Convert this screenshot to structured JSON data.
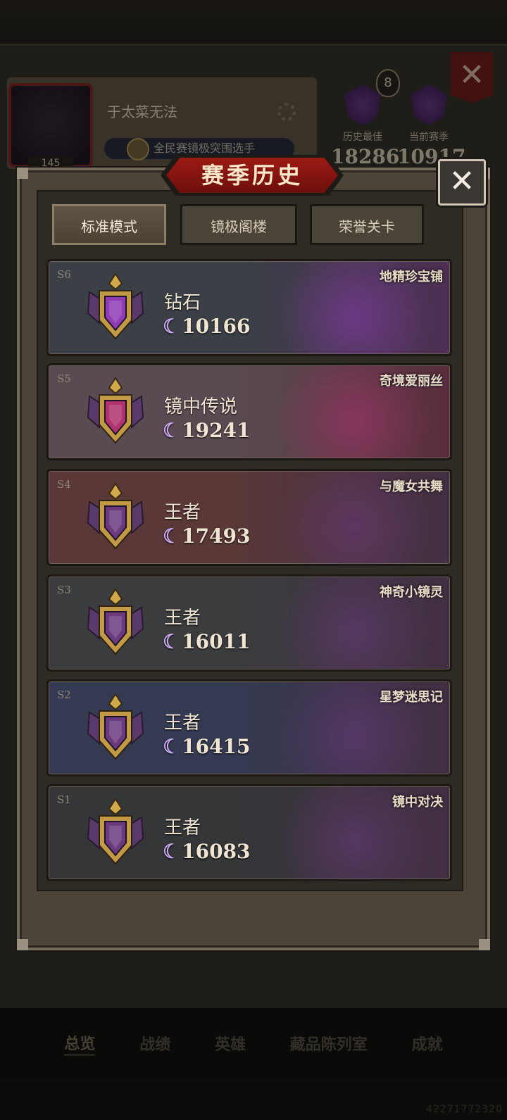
{
  "profile": {
    "player_name": "于太菜无法",
    "level": "145",
    "title_text": "全民赛镜极突围选手",
    "star_count": "8",
    "stats": [
      {
        "label": "历史最佳",
        "value": "18286"
      },
      {
        "label": "当前赛季",
        "value": "10917"
      }
    ]
  },
  "bottom_nav": [
    "总览",
    "战绩",
    "英雄",
    "藏品陈列室",
    "成就"
  ],
  "corner_id": "42271772320",
  "modal": {
    "title": "赛季历史",
    "close_symbol": "✕",
    "tabs": [
      "标准模式",
      "镜极阁楼",
      "荣誉关卡"
    ],
    "active_tab": 0
  },
  "seasons": [
    {
      "code": "S6",
      "rank": "钻石",
      "points": "10166",
      "theme": "地精珍宝铺",
      "emblem": "diamond-emblem-icon",
      "accent": "#8e3bb4",
      "bg": "#3a4046"
    },
    {
      "code": "S5",
      "rank": "镜中传说",
      "points": "19241",
      "theme": "奇境爱丽丝",
      "emblem": "legend-emblem-icon",
      "accent": "#b0326e",
      "bg": "#5a4b52"
    },
    {
      "code": "S4",
      "rank": "王者",
      "points": "17493",
      "theme": "与魔女共舞",
      "emblem": "king-emblem-icon",
      "accent": "#6b3a7e",
      "bg": "#5a3838"
    },
    {
      "code": "S3",
      "rank": "王者",
      "points": "16011",
      "theme": "神奇小镜灵",
      "emblem": "king-emblem-icon",
      "accent": "#6b3a7e",
      "bg": "#3a3c3e"
    },
    {
      "code": "S2",
      "rank": "王者",
      "points": "16415",
      "theme": "星梦迷思记",
      "emblem": "king-emblem-icon",
      "accent": "#6b3a7e",
      "bg": "#343a52"
    },
    {
      "code": "S1",
      "rank": "王者",
      "points": "16083",
      "theme": "镜中对决",
      "emblem": "king-emblem-icon",
      "accent": "#6b3a7e",
      "bg": "#343638"
    }
  ],
  "moon_symbol": "☾"
}
